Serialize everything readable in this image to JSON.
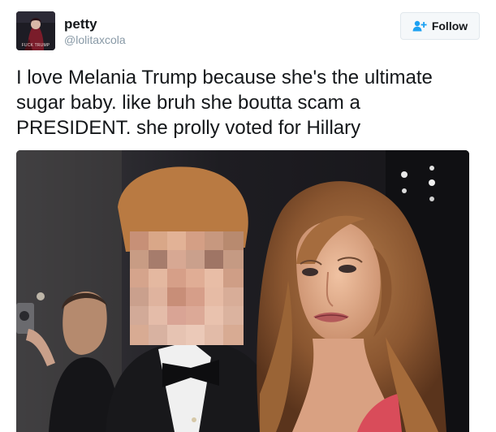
{
  "author": {
    "display_name": "petty",
    "handle": "@lolitaxcola",
    "avatar_caption": "FUCK TRUMP"
  },
  "follow_button": {
    "label": "Follow",
    "icon": "follow-person-plus-icon"
  },
  "tweet": {
    "text": "I love Melania Trump because she's the ultimate sugar baby. like bruh she boutta scam a PRESIDENT. she prolly voted for Hillary"
  },
  "media": {
    "kind": "photo",
    "subject": "couple-photo-pixelated-face"
  },
  "colors": {
    "text": "#14171a",
    "secondary_text": "#8899a6",
    "follow_icon": "#1da1f2",
    "button_bg": "#f5f8fa",
    "button_border": "#e1e8ed"
  }
}
